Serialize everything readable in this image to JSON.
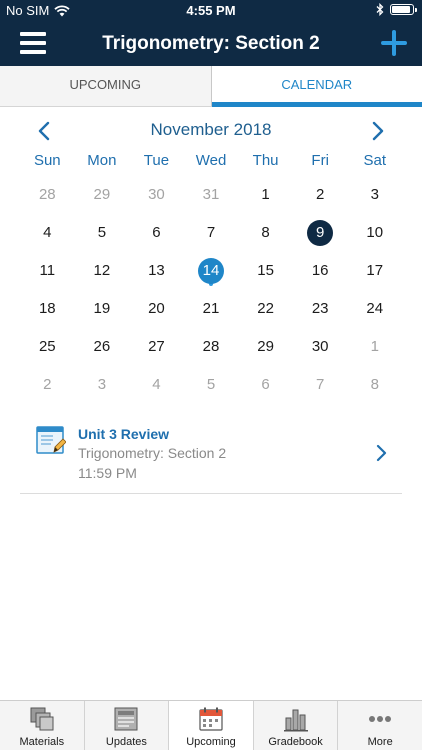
{
  "status_bar": {
    "carrier": "No SIM",
    "time": "4:55 PM"
  },
  "nav": {
    "title": "Trigonometry: Section 2",
    "menu_icon": "hamburger-menu-icon",
    "add_icon": "plus-icon"
  },
  "tabs": {
    "upcoming": "UPCOMING",
    "calendar": "CALENDAR",
    "active": "calendar"
  },
  "calendar": {
    "month_label": "November 2018",
    "weekdays": [
      "Sun",
      "Mon",
      "Tue",
      "Wed",
      "Thu",
      "Fri",
      "Sat"
    ],
    "weeks": [
      [
        {
          "d": "28",
          "muted": true
        },
        {
          "d": "29",
          "muted": true
        },
        {
          "d": "30",
          "muted": true
        },
        {
          "d": "31",
          "muted": true
        },
        {
          "d": "1"
        },
        {
          "d": "2"
        },
        {
          "d": "3"
        }
      ],
      [
        {
          "d": "4"
        },
        {
          "d": "5"
        },
        {
          "d": "6"
        },
        {
          "d": "7"
        },
        {
          "d": "8"
        },
        {
          "d": "9",
          "selected": true
        },
        {
          "d": "10"
        }
      ],
      [
        {
          "d": "11"
        },
        {
          "d": "12"
        },
        {
          "d": "13"
        },
        {
          "d": "14",
          "today": true,
          "event": true
        },
        {
          "d": "15"
        },
        {
          "d": "16"
        },
        {
          "d": "17"
        }
      ],
      [
        {
          "d": "18"
        },
        {
          "d": "19"
        },
        {
          "d": "20"
        },
        {
          "d": "21"
        },
        {
          "d": "22"
        },
        {
          "d": "23"
        },
        {
          "d": "24"
        }
      ],
      [
        {
          "d": "25"
        },
        {
          "d": "26"
        },
        {
          "d": "27"
        },
        {
          "d": "28"
        },
        {
          "d": "29"
        },
        {
          "d": "30"
        },
        {
          "d": "1",
          "muted": true
        }
      ],
      [
        {
          "d": "2",
          "muted": true
        },
        {
          "d": "3",
          "muted": true
        },
        {
          "d": "4",
          "muted": true
        },
        {
          "d": "5",
          "muted": true
        },
        {
          "d": "6",
          "muted": true
        },
        {
          "d": "7",
          "muted": true
        },
        {
          "d": "8",
          "muted": true
        }
      ]
    ]
  },
  "event": {
    "title": "Unit 3 Review",
    "course": "Trigonometry: Section 2",
    "time": "11:59 PM",
    "icon": "assignment-icon"
  },
  "tab_bar": {
    "items": [
      {
        "label": "Materials",
        "icon": "materials-icon"
      },
      {
        "label": "Updates",
        "icon": "updates-icon"
      },
      {
        "label": "Upcoming",
        "icon": "calendar-icon",
        "active": true
      },
      {
        "label": "Gradebook",
        "icon": "gradebook-icon"
      },
      {
        "label": "More",
        "icon": "more-icon"
      }
    ]
  },
  "colors": {
    "nav_bg": "#0f2a44",
    "accent": "#1f86c8",
    "selected_day": "#0f2a44"
  }
}
